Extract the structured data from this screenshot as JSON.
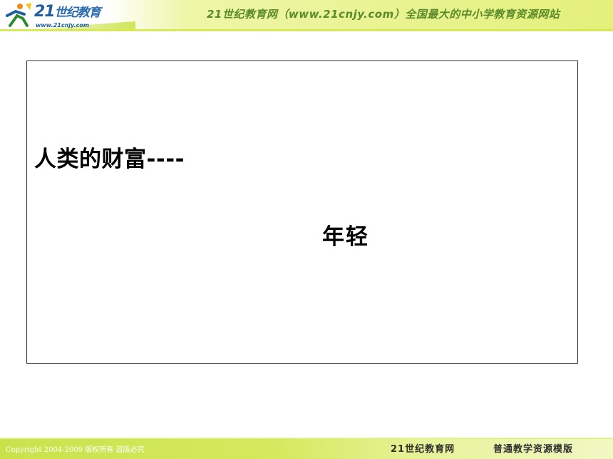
{
  "header": {
    "logo_main": "21",
    "logo_cn": "世纪教育",
    "logo_url": "www.21cnjy.com",
    "title": "21世纪教育网（www.21cnjy.com）全国最大的中小学教育资源网站"
  },
  "slide": {
    "headline": "人类的财富----",
    "subline": "年轻"
  },
  "footer": {
    "copyright": "Copyright 2004-2009 版权所有 盗版必究",
    "brand": "21世纪教育网",
    "tagline": "普通教学资源模版"
  },
  "colors": {
    "header_accent": "#e4f07a",
    "footer_accent": "#c9e24c",
    "logo_blue": "#1f5fa0",
    "header_title_green": "#5a8a2a"
  }
}
